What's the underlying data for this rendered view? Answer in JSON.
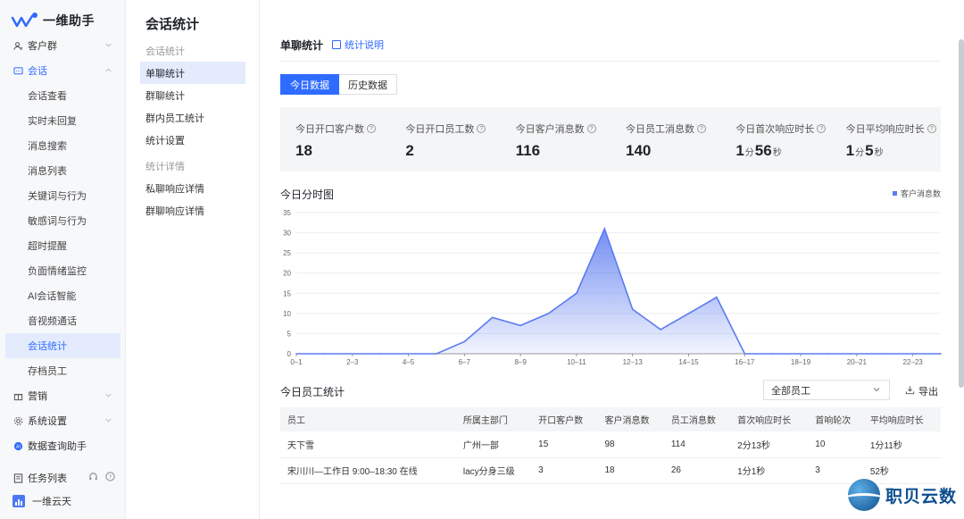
{
  "brand": {
    "name": "一维助手"
  },
  "sidebar": {
    "top": [
      {
        "label": "客户群",
        "icon": "users-icon",
        "expanded": false
      }
    ],
    "session": {
      "label": "会话",
      "icon": "chat-icon",
      "expanded": true
    },
    "session_items": [
      "会话查看",
      "实时未回复",
      "消息搜索",
      "消息列表",
      "关键词与行为",
      "敏感词与行为",
      "超时提醒",
      "负面情绪监控",
      "AI会话智能",
      "音视频通话",
      "会话统计",
      "存档员工"
    ],
    "active_sub": "会话统计",
    "bottom_groups": [
      {
        "label": "营销",
        "icon": "gift-icon",
        "expanded": false
      },
      {
        "label": "系统设置",
        "icon": "gear-icon",
        "expanded": false
      },
      {
        "label": "数据查询助手",
        "icon": "ai-icon"
      }
    ],
    "task_list": "任务列表",
    "user": "一维云天"
  },
  "subnav": {
    "page_title": "会话统计",
    "group1_header": "会话统计",
    "group1_items": [
      "单聊统计",
      "群聊统计",
      "群内员工统计",
      "统计设置"
    ],
    "active_item": "单聊统计",
    "group2_header": "统计详情",
    "group2_items": [
      "私聊响应详情",
      "群聊响应详情"
    ]
  },
  "main": {
    "title": "单聊统计",
    "help": "统计说明",
    "tabs": [
      {
        "label": "今日数据",
        "active": true
      },
      {
        "label": "历史数据",
        "active": false
      }
    ],
    "stats": [
      {
        "label": "今日开口客户数",
        "value": "18"
      },
      {
        "label": "今日开口员工数",
        "value": "2"
      },
      {
        "label": "今日客户消息数",
        "value": "116"
      },
      {
        "label": "今日员工消息数",
        "value": "140"
      },
      {
        "label": "今日首次响应时长",
        "min": "1",
        "min_unit": "分",
        "sec": "56",
        "sec_unit": "秒"
      },
      {
        "label": "今日平均响应时长",
        "min": "1",
        "min_unit": "分",
        "sec": "5",
        "sec_unit": "秒"
      }
    ],
    "chart_title": "今日分时图",
    "emp_title": "今日员工统计",
    "emp_filter": "全部员工",
    "export": "导出",
    "table": {
      "headers": [
        "员工",
        "所属主部门",
        "开口客户数",
        "客户消息数",
        "员工消息数",
        "首次响应时长",
        "首响轮次",
        "平均响应时长"
      ],
      "rows": [
        [
          "天下雪",
          "广州一部",
          "15",
          "98",
          "114",
          "2分13秒",
          "10",
          "1分11秒"
        ],
        [
          "宋川川—工作日 9:00–18:30 在线",
          "lacy分身三级",
          "3",
          "18",
          "26",
          "1分1秒",
          "3",
          "52秒"
        ]
      ]
    }
  },
  "watermark": "职贝云数",
  "colors": {
    "accent": "#2f6bff",
    "series": "#5b7bf0"
  },
  "chart_data": {
    "type": "area",
    "title": "今日分时图",
    "xlabel": "",
    "ylabel": "",
    "categories": [
      "0–1",
      "1–2",
      "2–3",
      "3–4",
      "4–5",
      "5–6",
      "6–7",
      "7–8",
      "8–9",
      "9–10",
      "10–11",
      "11–12",
      "12–13",
      "13–14",
      "14–15",
      "15–16",
      "16–17",
      "17–18",
      "18–19",
      "19–20",
      "20–21",
      "21–22",
      "22–23",
      "23–24"
    ],
    "tick_labels": [
      "0–1",
      "2–3",
      "4–5",
      "6–7",
      "8–9",
      "10–11",
      "12–13",
      "14–15",
      "16–17",
      "18–19",
      "20–21",
      "22–23"
    ],
    "series": [
      {
        "name": "客户消息数",
        "values": [
          0,
          0,
          0,
          0,
          0,
          0,
          3,
          9,
          7,
          10,
          15,
          31,
          11,
          6,
          10,
          14,
          0,
          0,
          0,
          0,
          0,
          0,
          0,
          0
        ]
      }
    ],
    "ylim": [
      0,
      35
    ],
    "yticks": [
      0,
      5,
      10,
      15,
      20,
      25,
      30,
      35
    ],
    "grid": true,
    "legend": "top-right"
  }
}
